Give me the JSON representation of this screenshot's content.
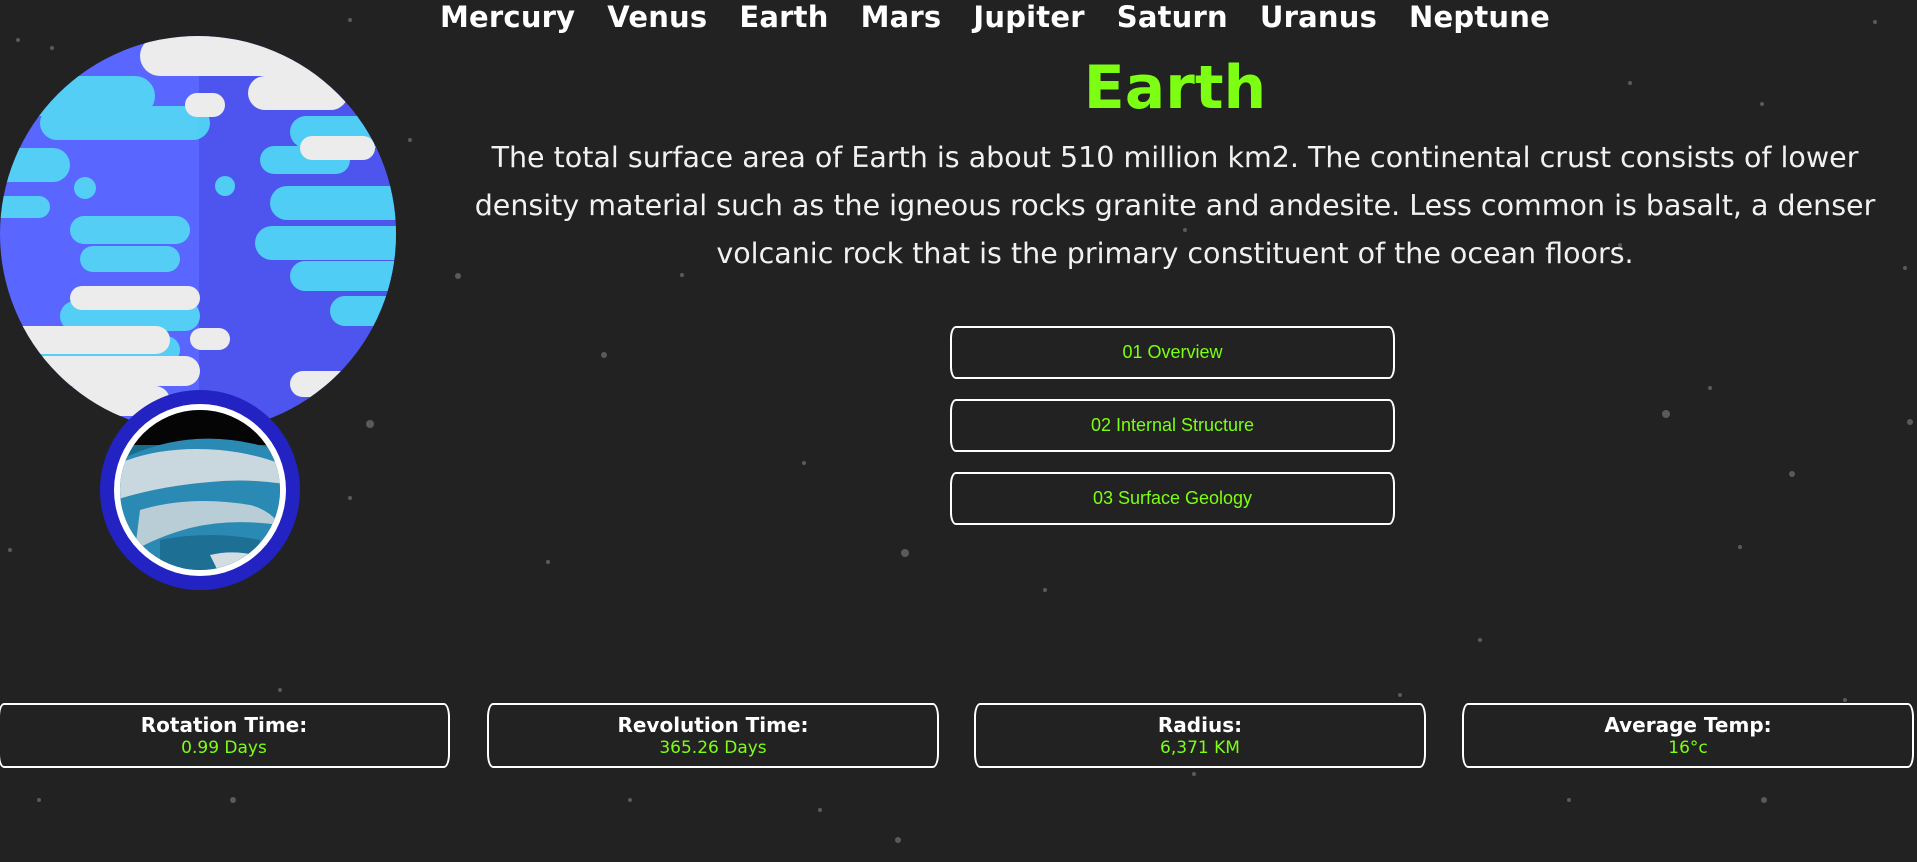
{
  "nav": {
    "items": [
      "Mercury",
      "Venus",
      "Earth",
      "Mars",
      "Jupiter",
      "Saturn",
      "Uranus",
      "Neptune"
    ]
  },
  "planet": {
    "name": "Earth",
    "description": "The total surface area of Earth is about 510 million km2. The continental crust consists of lower density material such as the igneous rocks granite and andesite. Less common is basalt, a denser volcanic rock that is the primary constituent of the ocean floors.",
    "icon": "earth-planet-icon",
    "inset_icon": "earth-surface-photo-icon"
  },
  "tabs": [
    {
      "label": "01 Overview"
    },
    {
      "label": "02 Internal Structure"
    },
    {
      "label": "03 Surface Geology"
    }
  ],
  "stats": [
    {
      "label": "Rotation Time:",
      "value": "0.99 Days"
    },
    {
      "label": "Revolution Time:",
      "value": "365.26 Days"
    },
    {
      "label": "Radius:",
      "value": "6,371 KM"
    },
    {
      "label": "Average Temp:",
      "value": "16°c"
    }
  ],
  "colors": {
    "background": "#222222",
    "accent": "#7cff12",
    "text": "#ffffff",
    "ocean": "#5462ff",
    "water_light": "#4fcdf5",
    "cloud": "#ececec",
    "inset_ring": "#2323c4"
  }
}
